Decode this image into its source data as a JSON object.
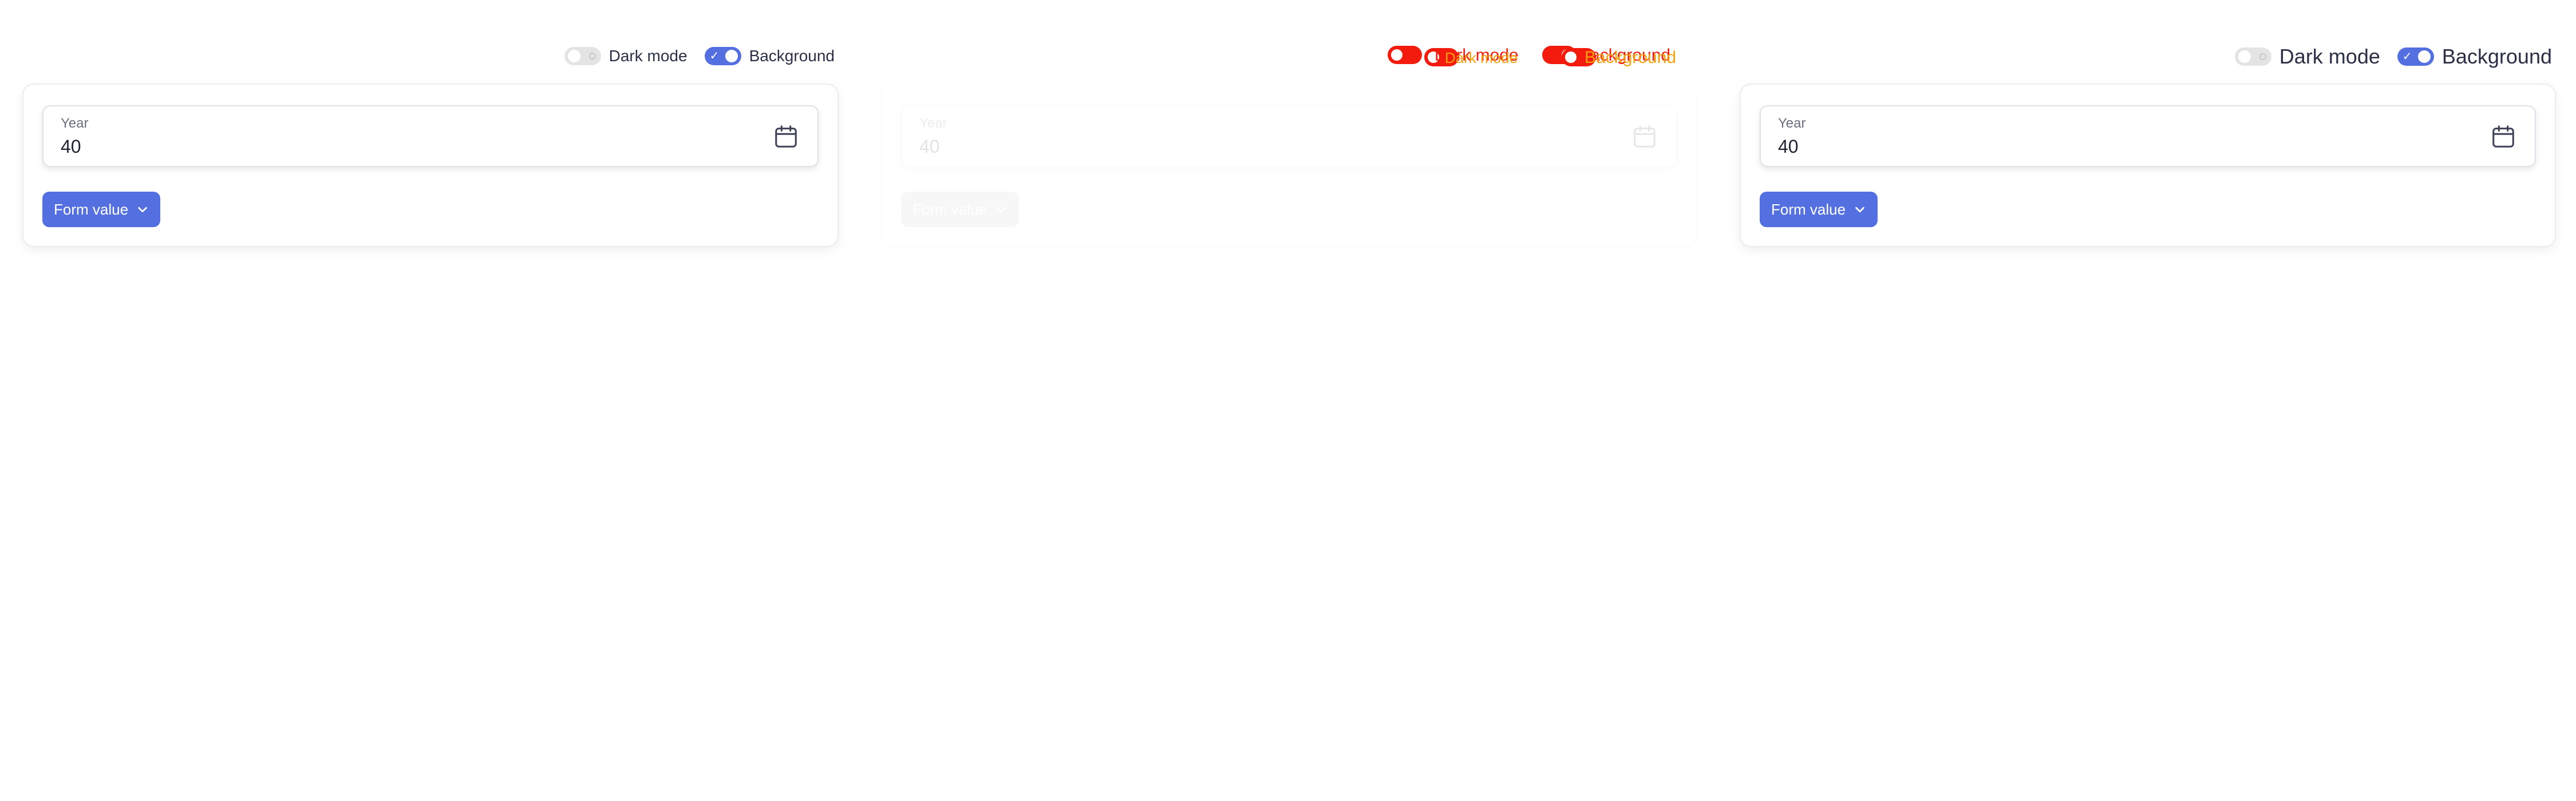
{
  "toggles": {
    "dark_mode_label": "Dark mode",
    "background_label": "Background",
    "dark_mode_on": false,
    "background_on": true
  },
  "field": {
    "label": "Year",
    "value": "40"
  },
  "form_button": {
    "label": "Form value"
  },
  "colors": {
    "accent": "#5470e0",
    "overlay_red": "#f21b0d",
    "overlay_orange": "#f5a10d"
  }
}
